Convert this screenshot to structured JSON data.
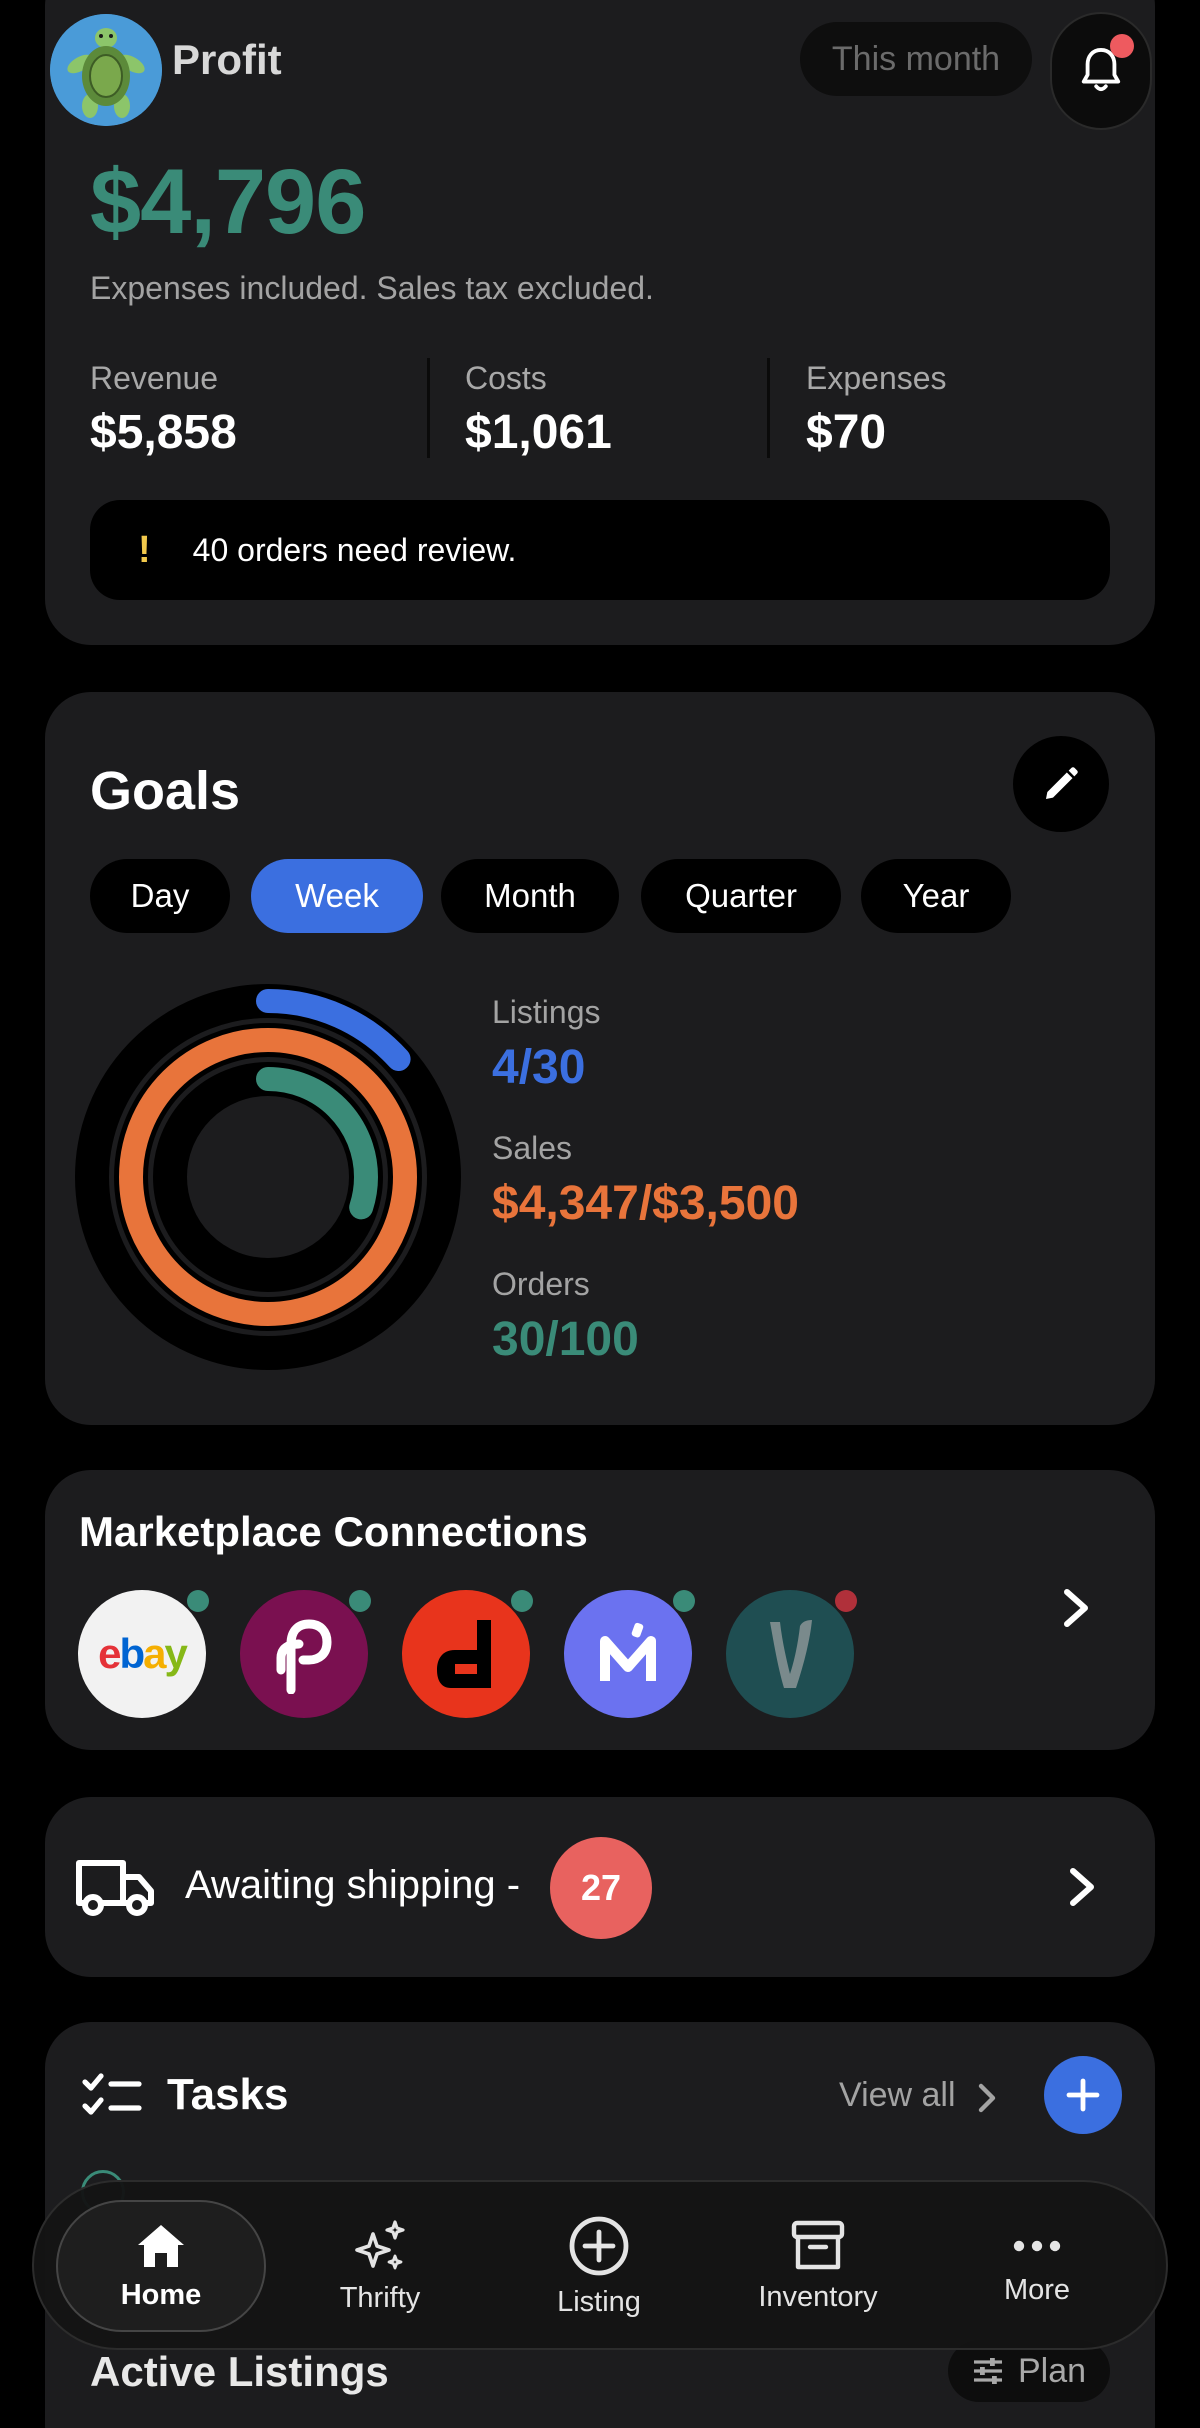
{
  "header": {
    "title": "Profit",
    "period_pill": "This month"
  },
  "profit": {
    "amount": "$4,796",
    "note": "Expenses included. Sales tax excluded.",
    "stats": [
      {
        "label": "Revenue",
        "value": "$5,858"
      },
      {
        "label": "Costs",
        "value": "$1,061"
      },
      {
        "label": "Expenses",
        "value": "$70"
      }
    ],
    "review_text": "40 orders need review."
  },
  "goals": {
    "title": "Goals",
    "periods": [
      "Day",
      "Week",
      "Month",
      "Quarter",
      "Year"
    ],
    "selected_period": "Week",
    "items": [
      {
        "label": "Listings",
        "value": "4/30",
        "progress": 0.133,
        "color": "#3b6fe0"
      },
      {
        "label": "Sales",
        "value": "$4,347/$3,500",
        "progress": 1.0,
        "color": "#e8743b"
      },
      {
        "label": "Orders",
        "value": "30/100",
        "progress": 0.3,
        "color": "#3a8b78"
      }
    ]
  },
  "marketplaces": {
    "title": "Marketplace Connections",
    "items": [
      {
        "name": "ebay",
        "label": "ebay",
        "bg": "#f2f2f2",
        "status": "connected"
      },
      {
        "name": "poshmark",
        "label": "P",
        "bg": "#7a1050",
        "status": "connected"
      },
      {
        "name": "depop",
        "label": "d",
        "bg": "#e8341c",
        "status": "connected"
      },
      {
        "name": "mercari",
        "label": "M",
        "bg": "#6b72f0",
        "status": "connected"
      },
      {
        "name": "vinted",
        "label": "V",
        "bg": "#1f4e52",
        "status": "disconnected"
      }
    ]
  },
  "shipping": {
    "text": "Awaiting shipping -",
    "count": "27"
  },
  "tasks": {
    "title": "Tasks",
    "view_all": "View all"
  },
  "active_listings": {
    "title": "Active Listings",
    "plan_label": "Plan"
  },
  "bottom_nav": {
    "items": [
      {
        "label": "Home",
        "icon": "home-icon",
        "active": true
      },
      {
        "label": "Thrifty",
        "icon": "sparkles-icon",
        "active": false
      },
      {
        "label": "Listing",
        "icon": "plus-circle-icon",
        "active": false
      },
      {
        "label": "Inventory",
        "icon": "archive-icon",
        "active": false
      },
      {
        "label": "More",
        "icon": "ellipsis-icon",
        "active": false
      }
    ]
  },
  "colors": {
    "profit_green": "#3a8b78",
    "accent_blue": "#3b6fe0",
    "sales_orange": "#e8743b",
    "alert_red": "#e8625f",
    "status_green": "#3a8b78",
    "status_red": "#b0303a"
  }
}
